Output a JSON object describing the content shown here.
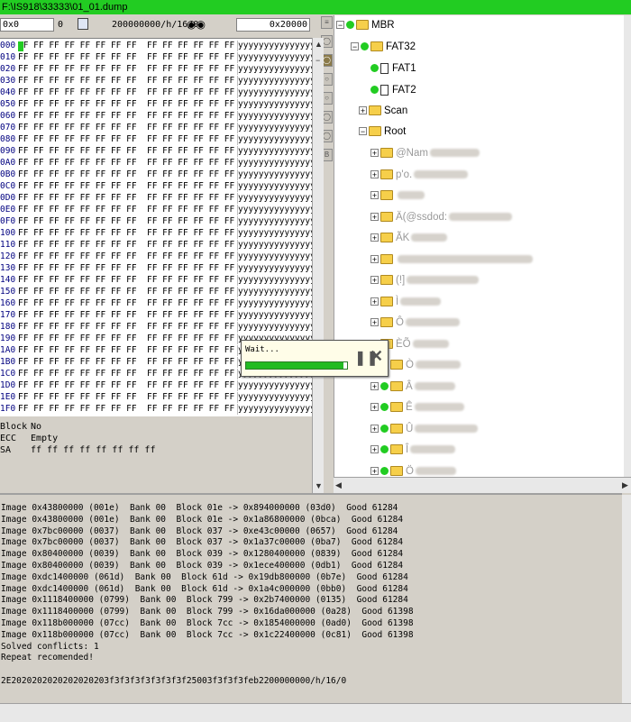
{
  "window": {
    "title": "F:\\IS918\\33333\\01_01.dump"
  },
  "toolbar": {
    "offset_field": "0x0",
    "value_field": "0",
    "address_field": "200000000/h/16/0",
    "size_field": "0x20000"
  },
  "hex": {
    "rows": [
      {
        "addr": "000",
        "bytes": "FF FF FF FF FF FF FF FF  FF FF FF FF FF FF FF FF",
        "ascii": "yyyyyyyyyyyyyyyy"
      },
      {
        "addr": "010",
        "bytes": "FF FF FF FF FF FF FF FF  FF FF FF FF FF FF FF FF",
        "ascii": "yyyyyyyyyyyyyyyy"
      },
      {
        "addr": "020",
        "bytes": "FF FF FF FF FF FF FF FF  FF FF FF FF FF FF FF FF",
        "ascii": "yyyyyyyyyyyyyyyy"
      },
      {
        "addr": "030",
        "bytes": "FF FF FF FF FF FF FF FF  FF FF FF FF FF FF FF FF",
        "ascii": "yyyyyyyyyyyyyyyy"
      },
      {
        "addr": "040",
        "bytes": "FF FF FF FF FF FF FF FF  FF FF FF FF FF FF FF FF",
        "ascii": "yyyyyyyyyyyyyyyy"
      },
      {
        "addr": "050",
        "bytes": "FF FF FF FF FF FF FF FF  FF FF FF FF FF FF FF FF",
        "ascii": "yyyyyyyyyyyyyyyy"
      },
      {
        "addr": "060",
        "bytes": "FF FF FF FF FF FF FF FF  FF FF FF FF FF FF FF FF",
        "ascii": "yyyyyyyyyyyyyyyy"
      },
      {
        "addr": "070",
        "bytes": "FF FF FF FF FF FF FF FF  FF FF FF FF FF FF FF FF",
        "ascii": "yyyyyyyyyyyyyyyy"
      },
      {
        "addr": "080",
        "bytes": "FF FF FF FF FF FF FF FF  FF FF FF FF FF FF FF FF",
        "ascii": "yyyyyyyyyyyyyyyy"
      },
      {
        "addr": "090",
        "bytes": "FF FF FF FF FF FF FF FF  FF FF FF FF FF FF FF FF",
        "ascii": "yyyyyyyyyyyyyyyy"
      },
      {
        "addr": "0A0",
        "bytes": "FF FF FF FF FF FF FF FF  FF FF FF FF FF FF FF FF",
        "ascii": "yyyyyyyyyyyyyyyy"
      },
      {
        "addr": "0B0",
        "bytes": "FF FF FF FF FF FF FF FF  FF FF FF FF FF FF FF FF",
        "ascii": "yyyyyyyyyyyyyyyy"
      },
      {
        "addr": "0C0",
        "bytes": "FF FF FF FF FF FF FF FF  FF FF FF FF FF FF FF FF",
        "ascii": "yyyyyyyyyyyyyyyy"
      },
      {
        "addr": "0D0",
        "bytes": "FF FF FF FF FF FF FF FF  FF FF FF FF FF FF FF FF",
        "ascii": "yyyyyyyyyyyyyyyy"
      },
      {
        "addr": "0E0",
        "bytes": "FF FF FF FF FF FF FF FF  FF FF FF FF FF FF FF FF",
        "ascii": "yyyyyyyyyyyyyyyy"
      },
      {
        "addr": "0F0",
        "bytes": "FF FF FF FF FF FF FF FF  FF FF FF FF FF FF FF FF",
        "ascii": "yyyyyyyyyyyyyyyy"
      },
      {
        "addr": "100",
        "bytes": "FF FF FF FF FF FF FF FF  FF FF FF FF FF FF FF FF",
        "ascii": "yyyyyyyyyyyyyyyy"
      },
      {
        "addr": "110",
        "bytes": "FF FF FF FF FF FF FF FF  FF FF FF FF FF FF FF FF",
        "ascii": "yyyyyyyyyyyyyyyy"
      },
      {
        "addr": "120",
        "bytes": "FF FF FF FF FF FF FF FF  FF FF FF FF FF FF FF FF",
        "ascii": "yyyyyyyyyyyyyyyy"
      },
      {
        "addr": "130",
        "bytes": "FF FF FF FF FF FF FF FF  FF FF FF FF FF FF FF FF",
        "ascii": "yyyyyyyyyyyyyyyy"
      },
      {
        "addr": "140",
        "bytes": "FF FF FF FF FF FF FF FF  FF FF FF FF FF FF FF FF",
        "ascii": "yyyyyyyyyyyyyyyy"
      },
      {
        "addr": "150",
        "bytes": "FF FF FF FF FF FF FF FF  FF FF FF FF FF FF FF FF",
        "ascii": "yyyyyyyyyyyyyyyy"
      },
      {
        "addr": "160",
        "bytes": "FF FF FF FF FF FF FF FF  FF FF FF FF FF FF FF FF",
        "ascii": "yyyyyyyyyyyyyyyy"
      },
      {
        "addr": "170",
        "bytes": "FF FF FF FF FF FF FF FF  FF FF FF FF FF FF FF FF",
        "ascii": "yyyyyyyyyyyyyyyy"
      },
      {
        "addr": "180",
        "bytes": "FF FF FF FF FF FF FF FF  FF FF FF FF FF FF FF FF",
        "ascii": "yyyyyyyyyyyyyyyy"
      },
      {
        "addr": "190",
        "bytes": "FF FF FF FF FF FF FF FF  FF FF FF FF FF FF FF FF",
        "ascii": "yyyyyyyyyyyyyyyy"
      },
      {
        "addr": "1A0",
        "bytes": "FF FF FF FF FF FF FF FF  FF FF FF FF FF FF FF FF",
        "ascii": "yyyyyyyyyyyyyyyy"
      },
      {
        "addr": "1B0",
        "bytes": "FF FF FF FF FF FF FF FF  FF FF FF FF FF FF FF FF",
        "ascii": "yyyyyyyyyyyyyyyy"
      },
      {
        "addr": "1C0",
        "bytes": "FF FF FF FF FF FF FF FF  FF FF FF FF FF FF FF FF",
        "ascii": "yyyyyyyyyyyyyyyy"
      },
      {
        "addr": "1D0",
        "bytes": "FF FF FF FF FF FF FF FF  FF FF FF FF FF FF FF FF",
        "ascii": "yyyyyyyyyyyyyyyy"
      },
      {
        "addr": "1E0",
        "bytes": "FF FF FF FF FF FF FF FF  FF FF FF FF FF FF FF FF",
        "ascii": "yyyyyyyyyyyyyyyy"
      },
      {
        "addr": "1F0",
        "bytes": "FF FF FF FF FF FF FF FF  FF FF FF FF FF FF FF FF",
        "ascii": "yyyyyyyyyyyyyyyy"
      }
    ]
  },
  "info": {
    "block_label": "Block",
    "block_value": "No",
    "ecc_label": "ECC",
    "ecc_value": "Empty",
    "sa_label": "SA",
    "sa_value": "ff ff ff ff ff ff ff ff"
  },
  "tree": {
    "mbr": "MBR",
    "fat32": "FAT32",
    "fat1": "FAT1",
    "fat2": "FAT2",
    "scan": "Scan",
    "root": "Root",
    "children": [
      {
        "label": "@Nam"
      },
      {
        "label": "p'o."
      },
      {
        "label": ""
      },
      {
        "label": "Ä(@ssdod:"
      },
      {
        "label": "ÃK"
      },
      {
        "label": ""
      },
      {
        "label": "(!]"
      },
      {
        "label": "Ì"
      },
      {
        "label": "Ô"
      },
      {
        "label": "ÈÕ"
      },
      {
        "label": "Ò"
      },
      {
        "label": "Â"
      },
      {
        "label": "Ê"
      },
      {
        "label": "Û"
      },
      {
        "label": "Î"
      },
      {
        "label": "Ö"
      },
      {
        "label": ""
      }
    ]
  },
  "log": {
    "lines": [
      "Image 0x43800000 (001e)  Bank 00  Block 01e -> 0x894000000 (03d0)  Good 61284",
      "Image 0x43800000 (001e)  Bank 00  Block 01e -> 0x1a86800000 (0bca)  Good 61284",
      "Image 0x7bc00000 (0037)  Bank 00  Block 037 -> 0xe43c00000 (0657)  Good 61284",
      "Image 0x7bc00000 (0037)  Bank 00  Block 037 -> 0x1a37c00000 (0ba7)  Good 61284",
      "Image 0x80400000 (0039)  Bank 00  Block 039 -> 0x1280400000 (0839)  Good 61284",
      "Image 0x80400000 (0039)  Bank 00  Block 039 -> 0x1ece400000 (0db1)  Good 61284",
      "Image 0xdc1400000 (061d)  Bank 00  Block 61d -> 0x19db800000 (0b7e)  Good 61284",
      "Image 0xdc1400000 (061d)  Bank 00  Block 61d -> 0x1a4c000000 (0bb0)  Good 61284",
      "Image 0x1118400000 (0799)  Bank 00  Block 799 -> 0x2b7400000 (0135)  Good 61284",
      "Image 0x1118400000 (0799)  Bank 00  Block 799 -> 0x16da000000 (0a28)  Good 61398",
      "Image 0x118b000000 (07cc)  Bank 00  Block 7cc -> 0x1854000000 (0ad0)  Good 61398",
      "Image 0x118b000000 (07cc)  Bank 00  Block 7cc -> 0x1c22400000 (0c81)  Good 61398",
      "Solved conflicts: 1",
      "Repeat recomended!",
      "",
      "2E2020202020202020203f3f3f3f3f3f3f3f25003f3f3f3feb2200000000/h/16/0"
    ]
  },
  "progress": {
    "text": "Wait...",
    "fraction": 0.96
  },
  "colors": {
    "title_bar": "#22cc22",
    "progress": "#22bb22"
  },
  "icons": {
    "toolbar_save": "floppy-icon",
    "toolbar_search": "binoculars-icon",
    "pause": "pause-icon",
    "stop": "close-icon"
  }
}
